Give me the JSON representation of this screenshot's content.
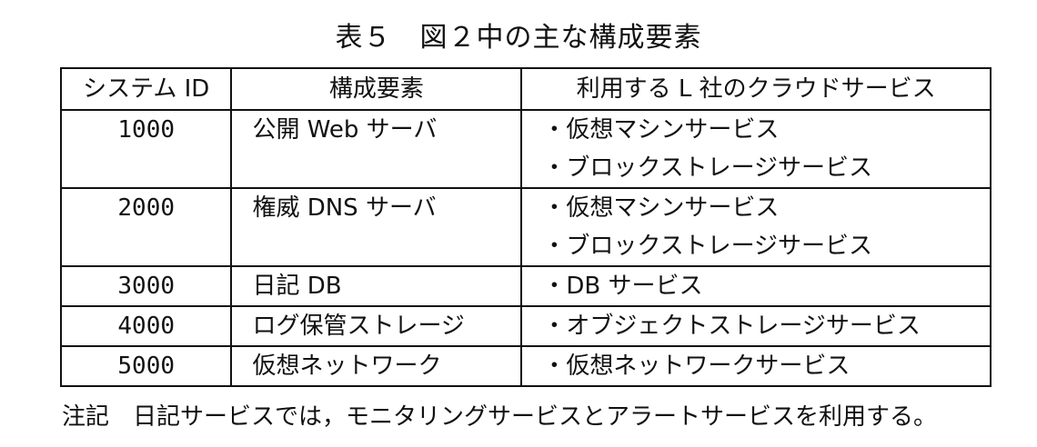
{
  "title": "表５　図２中の主な構成要素",
  "table": {
    "headers": [
      "システム ID",
      "構成要素",
      "利用する L 社のクラウドサービス"
    ],
    "rows": [
      {
        "id": "1000",
        "component": "公開 Web サーバ",
        "services": [
          "・仮想マシンサービス",
          "・ブロックストレージサービス"
        ]
      },
      {
        "id": "2000",
        "component": "権威 DNS サーバ",
        "services": [
          "・仮想マシンサービス",
          "・ブロックストレージサービス"
        ]
      },
      {
        "id": "3000",
        "component": "日記 DB",
        "services": [
          "・DB サービス"
        ]
      },
      {
        "id": "4000",
        "component": "ログ保管ストレージ",
        "services": [
          "・オブジェクトストレージサービス"
        ]
      },
      {
        "id": "5000",
        "component": "仮想ネットワーク",
        "services": [
          "・仮想ネットワークサービス"
        ]
      }
    ]
  },
  "note": "注記　日記サービスでは，モニタリングサービスとアラートサービスを利用する。"
}
